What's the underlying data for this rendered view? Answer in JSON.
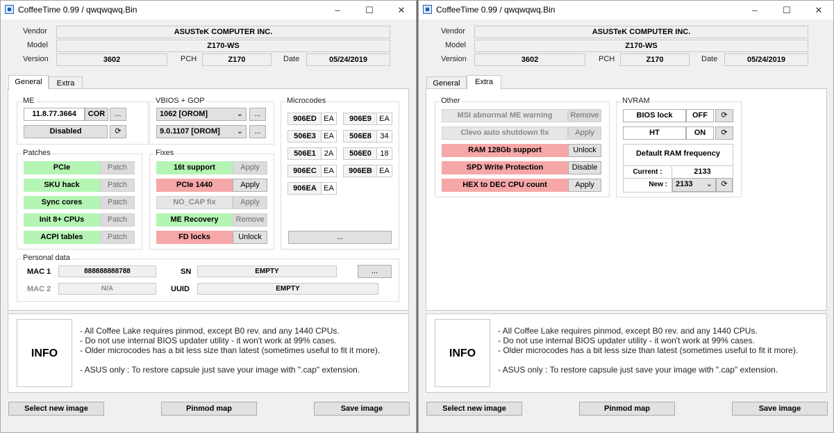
{
  "window_left": {
    "title": "CoffeeTime 0.99  /  qwqwqwq.Bin",
    "vendor_label": "Vendor",
    "vendor": "ASUSTeK COMPUTER INC.",
    "model_label": "Model",
    "model": "Z170-WS",
    "version_label": "Version",
    "version": "3602",
    "pch_label": "PCH",
    "pch": "Z170",
    "date_label": "Date",
    "date": "05/24/2019",
    "tabs": [
      {
        "label": "General",
        "active": true
      },
      {
        "label": "Extra",
        "active": false
      }
    ],
    "me": {
      "title": "ME",
      "version": "11.8.77.3664",
      "type": "COR",
      "more": "...",
      "state": "Disabled"
    },
    "vbios": {
      "title": "VBIOS + GOP",
      "vbios_value": "1062 [OROM]",
      "gop_value": "9.0.1107 [OROM]",
      "more": "..."
    },
    "microcodes": {
      "title": "Microcodes",
      "items": [
        {
          "id": "906ED",
          "rev": "EA"
        },
        {
          "id": "906E9",
          "rev": "EA"
        },
        {
          "id": "506E3",
          "rev": "EA"
        },
        {
          "id": "506E8",
          "rev": "34"
        },
        {
          "id": "506E1",
          "rev": "2A"
        },
        {
          "id": "506E0",
          "rev": "18"
        },
        {
          "id": "906EC",
          "rev": "EA"
        },
        {
          "id": "906EB",
          "rev": "EA"
        },
        {
          "id": "906EA",
          "rev": "EA"
        }
      ],
      "more": "..."
    },
    "patches": {
      "title": "Patches",
      "items": [
        {
          "label": "PCIe",
          "action": "Patch"
        },
        {
          "label": "SKU hack",
          "action": "Patch"
        },
        {
          "label": "Sync cores",
          "action": "Patch"
        },
        {
          "label": "Init 8+ CPUs",
          "action": "Patch"
        },
        {
          "label": "ACPI tables",
          "action": "Patch"
        }
      ]
    },
    "fixes": {
      "title": "Fixes",
      "items": [
        {
          "label": "16t support",
          "action": "Apply"
        },
        {
          "label": "PCIe 1440",
          "action": "Apply"
        },
        {
          "label": "NO_CAP fix",
          "action": "Apply"
        },
        {
          "label": "ME Recovery",
          "action": "Remove"
        },
        {
          "label": "FD locks",
          "action": "Unlock"
        }
      ]
    },
    "personal": {
      "title": "Personal data",
      "mac1_label": "MAC 1",
      "mac1": "888888888788",
      "mac2_label": "MAC 2",
      "mac2": "N/A",
      "sn_label": "SN",
      "sn": "EMPTY",
      "uuid_label": "UUID",
      "uuid": "EMPTY",
      "more": "..."
    },
    "info": {
      "label": "INFO",
      "lines": "- All Coffee Lake requires pinmod, except B0 rev. and any 1440 CPUs.\n- Do not use internal BIOS updater utility - it won't work at 99% cases.\n- Older microcodes has a bit less size than latest (sometimes useful to fit it more).\n\n- ASUS only : To restore capsule just save your image with \".cap\" extension."
    },
    "buttons": {
      "select": "Select new image",
      "pinmod": "Pinmod map",
      "save": "Save image"
    }
  },
  "window_right": {
    "title": "CoffeeTime 0.99  /  qwqwqwq.Bin",
    "vendor_label": "Vendor",
    "vendor": "ASUSTeK COMPUTER INC.",
    "model_label": "Model",
    "model": "Z170-WS",
    "version_label": "Version",
    "version": "3602",
    "pch_label": "PCH",
    "pch": "Z170",
    "date_label": "Date",
    "date": "05/24/2019",
    "tabs": [
      {
        "label": "General",
        "active": false
      },
      {
        "label": "Extra",
        "active": true
      }
    ],
    "other": {
      "title": "Other",
      "items": [
        {
          "label": "MSI abnormal ME warning",
          "action": "Remove"
        },
        {
          "label": "Clevo auto shutdown fix",
          "action": "Apply"
        },
        {
          "label": "RAM 128Gb support",
          "action": "Unlock"
        },
        {
          "label": "SPD Write Protection",
          "action": "Disable"
        },
        {
          "label": "HEX to DEC CPU count",
          "action": "Apply"
        }
      ]
    },
    "nvram": {
      "title": "NVRAM",
      "bios_lock_label": "BIOS lock",
      "bios_lock_value": "OFF",
      "ht_label": "HT",
      "ht_value": "ON",
      "ram_freq_title": "Default RAM frequency",
      "current_label": "Current :",
      "current_value": "2133",
      "new_label": "New :",
      "new_value": "2133"
    },
    "info": {
      "label": "INFO",
      "lines": "- All Coffee Lake requires pinmod, except B0 rev. and any 1440 CPUs.\n- Do not use internal BIOS updater utility - it won't work at 99% cases.\n- Older microcodes has a bit less size than latest (sometimes useful to fit it more).\n\n- ASUS only : To restore capsule just save your image with \".cap\" extension."
    },
    "buttons": {
      "select": "Select new image",
      "pinmod": "Pinmod map",
      "save": "Save image"
    }
  },
  "icons": {
    "minimize": "minimize-icon",
    "maximize": "maximize-icon",
    "close": "close-icon",
    "refresh": "refresh-icon"
  }
}
